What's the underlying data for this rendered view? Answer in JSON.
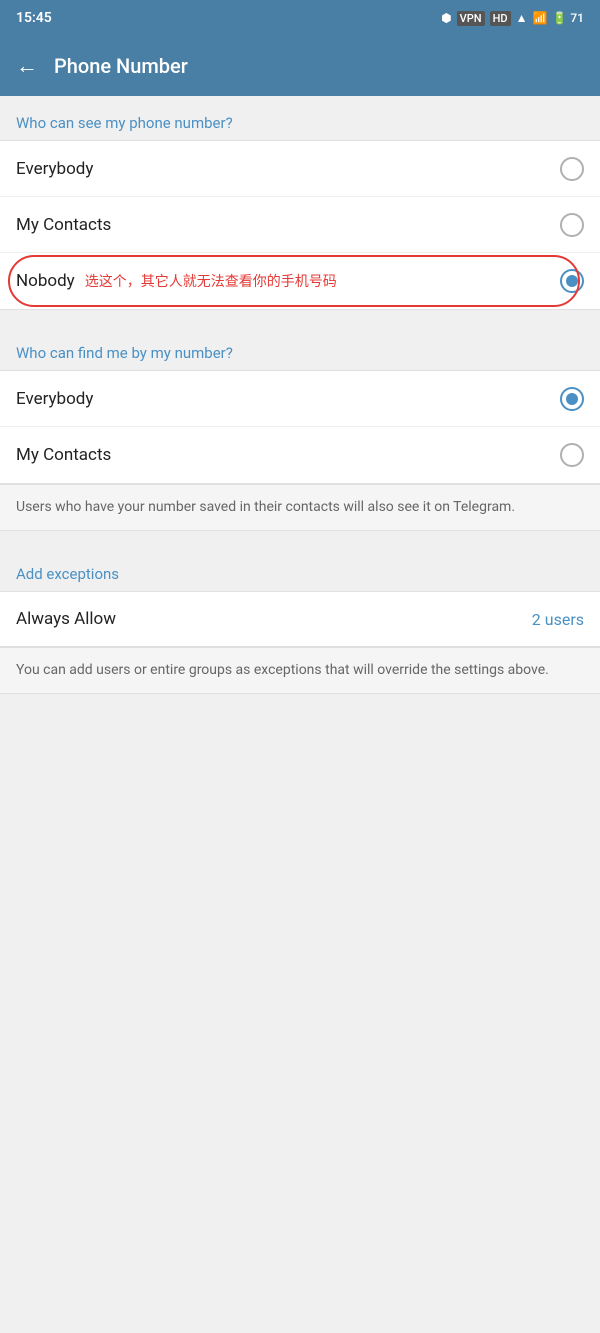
{
  "statusBar": {
    "time": "15:45",
    "icons": "🔷 VPN HD ▲ ≋ 71"
  },
  "appBar": {
    "backIcon": "←",
    "title": "Phone Number"
  },
  "section1": {
    "heading": "Who can see my phone number?",
    "options": [
      {
        "label": "Everybody",
        "selected": false,
        "annotation": ""
      },
      {
        "label": "My Contacts",
        "selected": false,
        "annotation": ""
      },
      {
        "label": "Nobody",
        "selected": true,
        "annotation": "选这个，其它人就无法查看你的手机号码"
      }
    ]
  },
  "section2": {
    "heading": "Who can find me by my number?",
    "options": [
      {
        "label": "Everybody",
        "selected": true,
        "annotation": ""
      },
      {
        "label": "My Contacts",
        "selected": false,
        "annotation": ""
      }
    ],
    "infoText": "Users who have your number saved in their contacts will also see it on Telegram."
  },
  "exceptions": {
    "heading": "Add exceptions",
    "alwaysAllow": {
      "label": "Always Allow",
      "value": "2 users"
    },
    "infoText": "You can add users or entire groups as exceptions that will override the settings above."
  }
}
